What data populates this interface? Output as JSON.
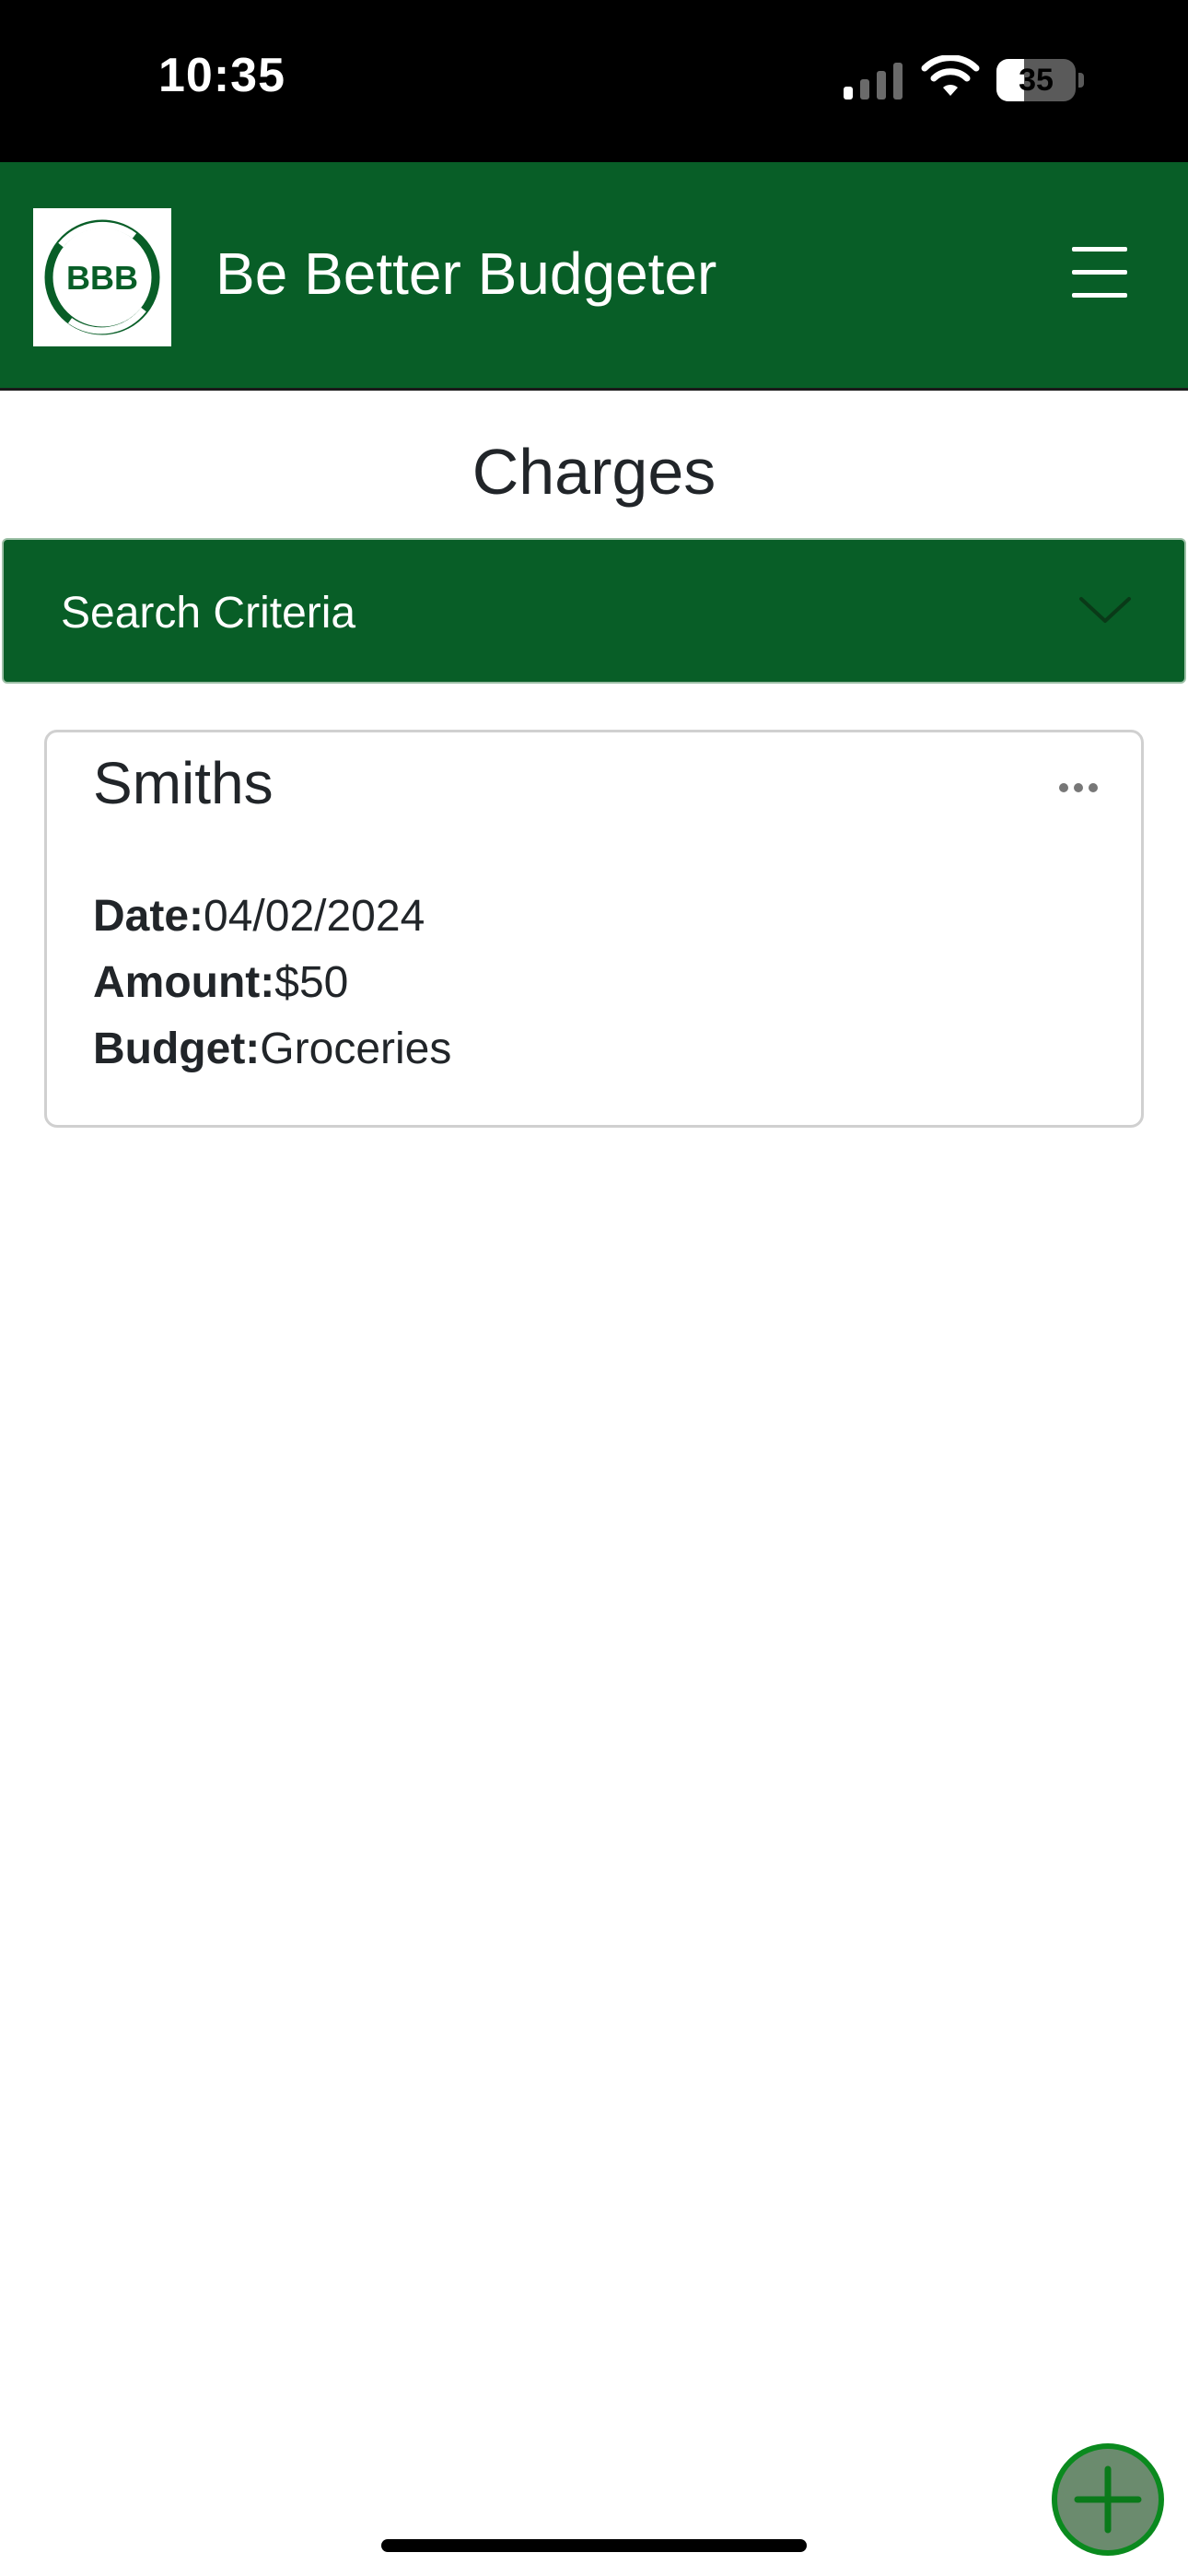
{
  "status_bar": {
    "time": "10:35",
    "battery_level": "35",
    "battery_fraction": 0.35,
    "icons": [
      "signal-icon",
      "wifi-icon",
      "battery-icon"
    ]
  },
  "header": {
    "logo_text": "BBB",
    "app_title": "Be Better Budgeter",
    "menu_icon": "hamburger-menu-icon"
  },
  "page": {
    "title": "Charges"
  },
  "search": {
    "label": "Search Criteria",
    "toggle_icon": "chevron-down-icon"
  },
  "charges": [
    {
      "name": "Smiths",
      "date_label": "Date:",
      "date": "04/02/2024",
      "amount_label": "Amount:",
      "amount": "$50",
      "budget_label": "Budget:",
      "budget": "Groceries",
      "actions_icon": "more-horizontal-icon"
    }
  ],
  "fab": {
    "icon": "plus-icon"
  },
  "colors": {
    "brand_green": "#085e27",
    "fab_border": "#0a8a1e",
    "fab_fill": "#6b8b6e"
  }
}
